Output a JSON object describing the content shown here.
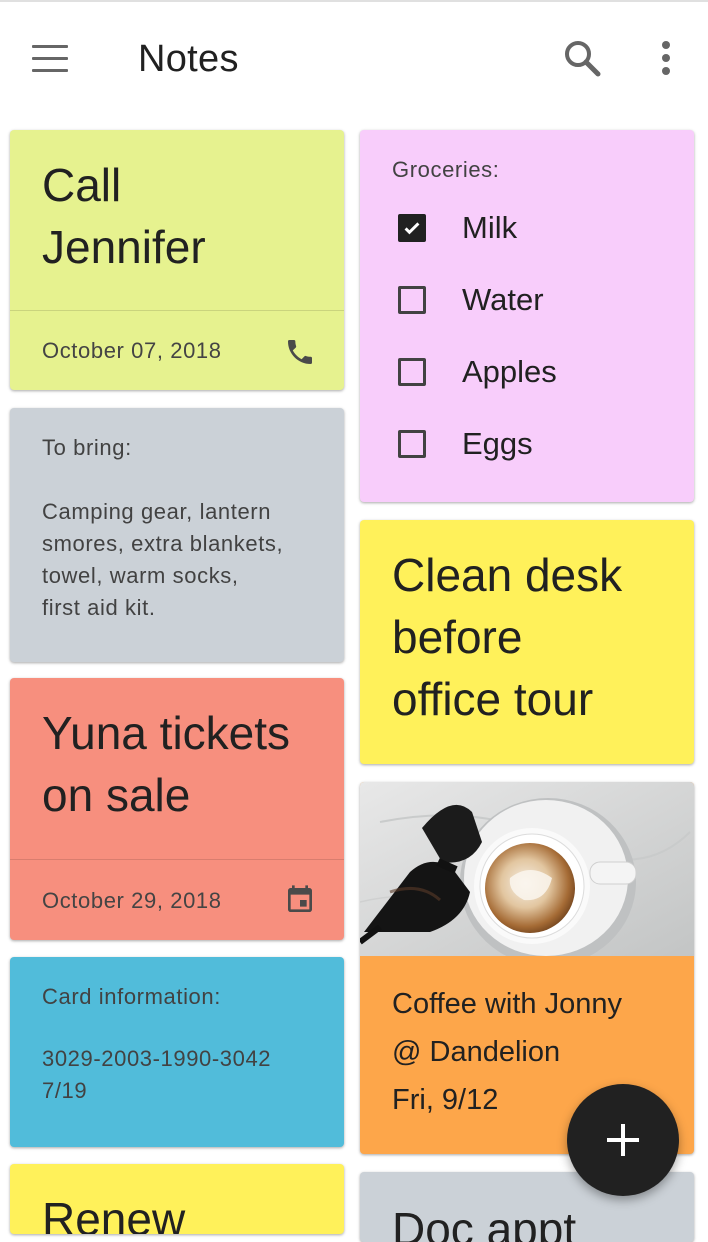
{
  "app": {
    "title": "Notes"
  },
  "toolbar": {
    "menu_icon": "hamburger-menu-icon",
    "search_icon": "search-icon",
    "more_icon": "more-vert-icon"
  },
  "notes": [
    {
      "id": "call-jennifer",
      "title": "Call Jennifer",
      "lines": [
        "Call",
        "Jennifer"
      ],
      "date": "October 07, 2018",
      "icon": "phone-icon",
      "color": "#e6f28f"
    },
    {
      "id": "to-bring",
      "heading": "To bring:",
      "body_lines": [
        "Camping gear, lantern",
        "smores, extra blankets,",
        "towel, warm socks,",
        "first aid kit."
      ],
      "color": "#cbd1d7"
    },
    {
      "id": "yuna",
      "lines": [
        "Yuna tickets",
        "on sale"
      ],
      "date": "October 29, 2018",
      "icon": "calendar-icon",
      "color": "#f78f7e"
    },
    {
      "id": "card",
      "heading": "Card information:",
      "body_lines": [
        "3029-2003-1990-3042",
        "7/19"
      ],
      "color": "#51bcda"
    },
    {
      "id": "renew",
      "lines": [
        "Renew"
      ],
      "color": "#fff15a"
    },
    {
      "id": "groceries",
      "heading": "Groceries:",
      "items": [
        {
          "label": "Milk",
          "checked": true
        },
        {
          "label": "Water",
          "checked": false
        },
        {
          "label": "Apples",
          "checked": false
        },
        {
          "label": "Eggs",
          "checked": false
        }
      ],
      "color": "#f8cdfb"
    },
    {
      "id": "clean-desk",
      "lines": [
        "Clean desk",
        "before",
        "office tour"
      ],
      "color": "#fff15a"
    },
    {
      "id": "coffee",
      "lines": [
        "Coffee with Jonny",
        "@ Dandelion",
        "Fri, 9/12"
      ],
      "image": "coffee-cup-with-sunglasses",
      "color": "#fda64a"
    },
    {
      "id": "doc",
      "lines": [
        "Doc appt"
      ],
      "color": "#cbd1d7"
    }
  ],
  "fab": {
    "icon": "add-icon"
  }
}
